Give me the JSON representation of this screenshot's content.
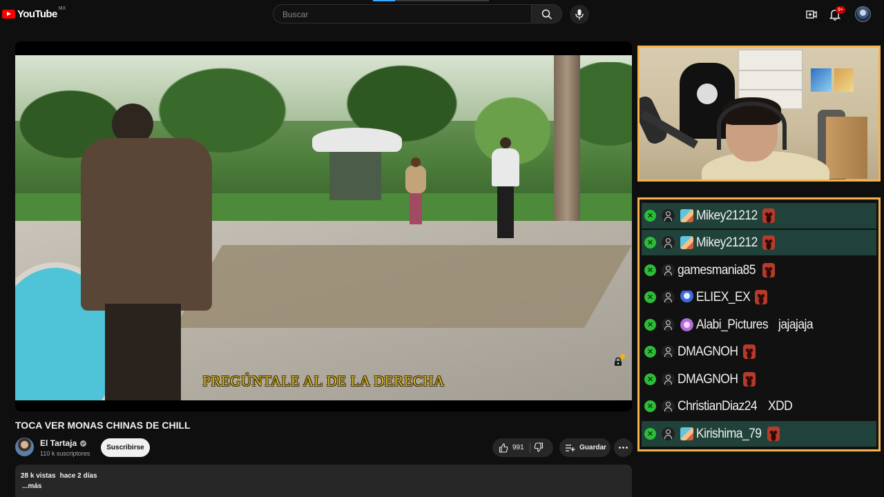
{
  "header": {
    "logo_text": "YouTube",
    "region": "MX",
    "search_placeholder": "Buscar",
    "notifications_badge": "9+"
  },
  "player": {
    "subtitle": "PREGÚNTALE AL DE LA DERECHA"
  },
  "video": {
    "title": "TOCA VER MONAS CHINAS DE CHILL",
    "channel_name": "El Tartaja",
    "subscribers": "110 k suscriptores",
    "subscribe_label": "Suscribirse",
    "likes": "991",
    "save_label": "Guardar",
    "views": "28 k vistas",
    "age": "hace 2 días",
    "more_label": "...más"
  },
  "chat": {
    "messages": [
      {
        "user": "Mikey21212",
        "avatar": "anime",
        "text": "",
        "emote": true,
        "highlight": true
      },
      {
        "user": "Mikey21212",
        "avatar": "anime",
        "text": "",
        "emote": true,
        "highlight": true
      },
      {
        "user": "gamesmania85",
        "avatar": "none",
        "text": "",
        "emote": true,
        "highlight": false
      },
      {
        "user": "ELIEX_EX",
        "avatar": "bot",
        "text": "",
        "emote": true,
        "highlight": false
      },
      {
        "user": "Alabi_Pictures",
        "avatar": "purple",
        "text": "jajajaja",
        "emote": false,
        "highlight": false
      },
      {
        "user": "DMAGNOH",
        "avatar": "none",
        "text": "",
        "emote": true,
        "highlight": false
      },
      {
        "user": "DMAGNOH",
        "avatar": "none",
        "text": "",
        "emote": true,
        "highlight": false
      },
      {
        "user": "ChristianDiaz24",
        "avatar": "none",
        "text": "XDD",
        "emote": false,
        "highlight": false
      },
      {
        "user": "Kirishima_79",
        "avatar": "anime",
        "text": "",
        "emote": true,
        "highlight": true
      }
    ]
  },
  "colors": {
    "accent_frame": "#f5b44c",
    "chat_highlight": "#20423a",
    "xbox_green": "#2cbd38",
    "brand_red": "#ff0000"
  }
}
